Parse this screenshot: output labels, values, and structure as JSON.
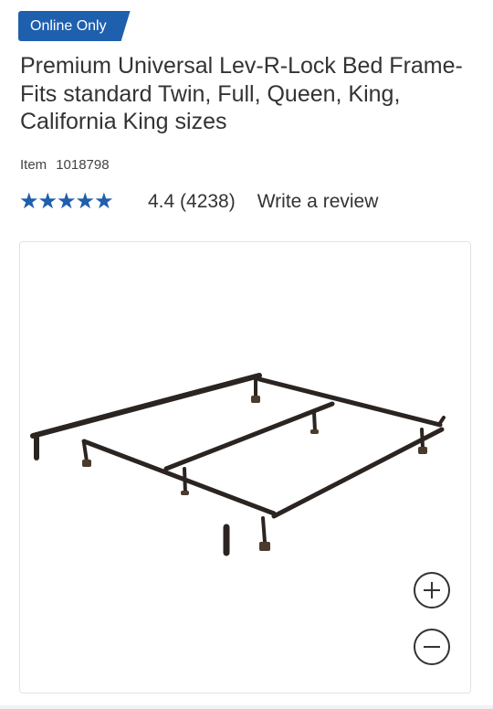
{
  "badge": {
    "label": "Online Only",
    "color": "#1e5fae"
  },
  "product": {
    "title": "Premium Universal Lev-R-Lock Bed Frame- Fits standard Twin, Full, Queen, King, California King sizes",
    "item_label": "Item",
    "item_number": "1018798"
  },
  "rating": {
    "value": 4.4,
    "max": 5,
    "display": "4.4 (4238)",
    "write_review": "Write a review",
    "star_color": "#1e5fae"
  },
  "image": {
    "subject": "bed-frame",
    "zoom_in_icon": "plus-icon",
    "zoom_out_icon": "minus-icon"
  }
}
